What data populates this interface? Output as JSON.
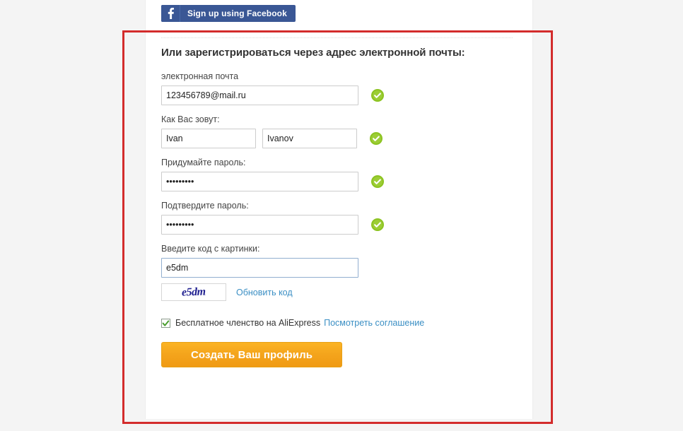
{
  "social": {
    "facebook_button_label": "Sign up using Facebook",
    "facebook_icon": "facebook-f-icon",
    "facebook_brand_color": "#3a5795"
  },
  "form": {
    "heading": "Или зарегистрироваться через адрес электронной почты:",
    "email": {
      "label": "электронная почта",
      "value": "123456789@mail.ru",
      "placeholder": "",
      "valid_icon": "green-check-icon"
    },
    "name": {
      "label": "Как Вас зовут:",
      "first_value": "Ivan",
      "first_placeholder": "",
      "last_value": "Ivanov",
      "last_placeholder": "",
      "valid_icon": "green-check-icon"
    },
    "password": {
      "label": "Придумайте пароль:",
      "value": "•••••••••",
      "placeholder": "",
      "valid_icon": "green-check-icon"
    },
    "password_confirm": {
      "label": "Подтвердите пароль:",
      "value": "•••••••••",
      "placeholder": "",
      "valid_icon": "green-check-icon"
    },
    "captcha": {
      "label": "Введите код с картинки:",
      "value": "e5dm",
      "placeholder": "",
      "image_text": "e5dm",
      "refresh_label": "Обновить код"
    },
    "agreement": {
      "checkbox_checked": true,
      "text": "Бесплатное членство на AliExpress",
      "link_label": "Посмотреть соглашение"
    },
    "submit_label": "Создать Ваш профиль"
  },
  "annotation": {
    "highlight_color": "#d32c2c"
  }
}
